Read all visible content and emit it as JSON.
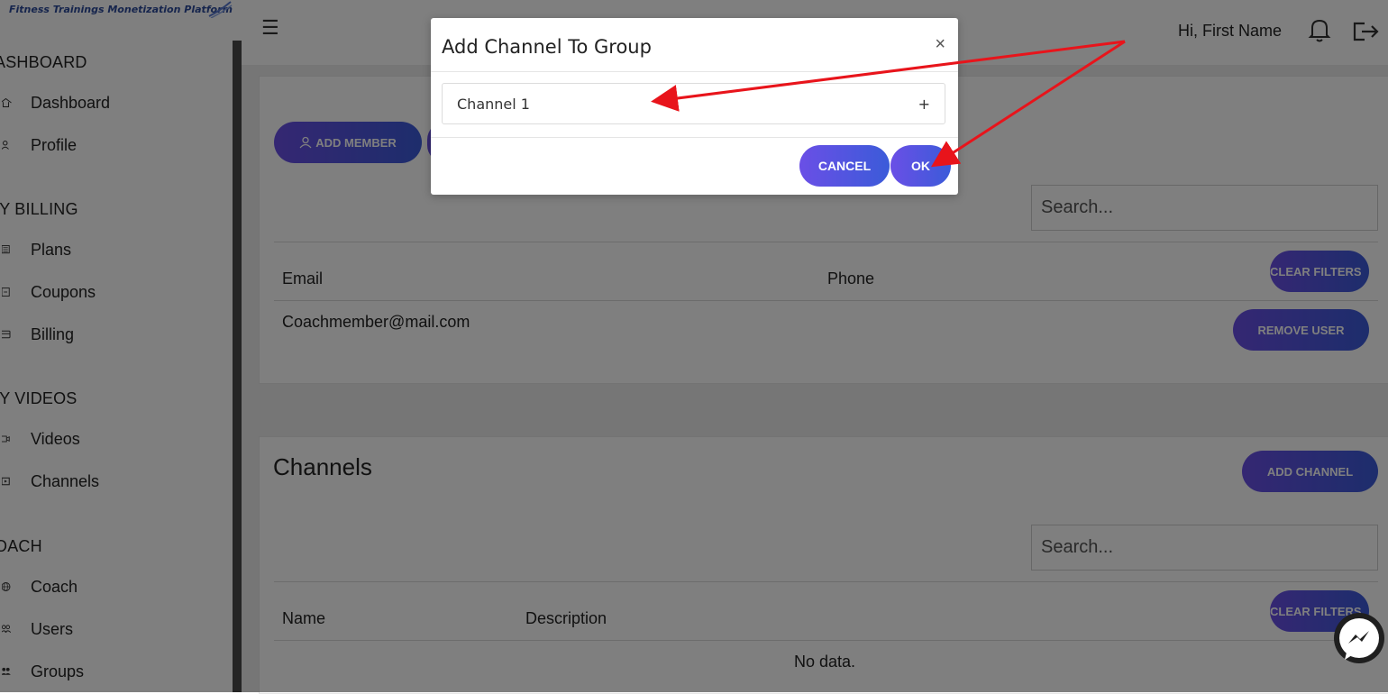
{
  "brand": {
    "tagline": "Fitness Trainings Monetization Platform"
  },
  "sidebar": {
    "sections": [
      {
        "title": "ASHBOARD",
        "items": [
          {
            "label": "Dashboard",
            "icon": "home-icon"
          },
          {
            "label": "Profile",
            "icon": "user-icon"
          }
        ]
      },
      {
        "title": "IY BILLING",
        "items": [
          {
            "label": "Plans",
            "icon": "list-icon"
          },
          {
            "label": "Coupons",
            "icon": "coupon-icon"
          },
          {
            "label": "Billing",
            "icon": "card-icon"
          }
        ]
      },
      {
        "title": "IY VIDEOS",
        "items": [
          {
            "label": "Videos",
            "icon": "video-icon"
          },
          {
            "label": "Channels",
            "icon": "channel-icon"
          }
        ]
      },
      {
        "title": "OACH",
        "items": [
          {
            "label": "Coach",
            "icon": "globe-icon"
          },
          {
            "label": "Users",
            "icon": "users-icon"
          },
          {
            "label": "Groups",
            "icon": "groups-icon"
          }
        ]
      }
    ]
  },
  "header": {
    "menu_icon": "hamburger-icon",
    "greeting": "Hi, First Name",
    "bell_icon": "bell-icon",
    "logout_icon": "logout-icon"
  },
  "members_card": {
    "add_member_label": "ADD MEMBER",
    "search_placeholder": "Search...",
    "columns": [
      "Email",
      "Phone"
    ],
    "clear_filters_label": "CLEAR FILTERS",
    "rows": [
      {
        "email": "Coachmember@mail.com",
        "phone": "",
        "action": "REMOVE USER"
      }
    ]
  },
  "channels_card": {
    "title": "Channels",
    "add_channel_label": "ADD CHANNEL",
    "search_placeholder": "Search...",
    "columns": [
      "Name",
      "Description"
    ],
    "clear_filters_label": "CLEAR FILTERS",
    "empty_text": "No data."
  },
  "modal": {
    "title": "Add Channel To Group",
    "close_symbol": "×",
    "channel_name": "Channel 1",
    "add_symbol": "+",
    "cancel_label": "CANCEL",
    "ok_label": "OK"
  },
  "colors": {
    "accent_start": "#6a4fe6",
    "accent_end": "#3b5bd9",
    "annotation_arrow": "#e8141b"
  }
}
